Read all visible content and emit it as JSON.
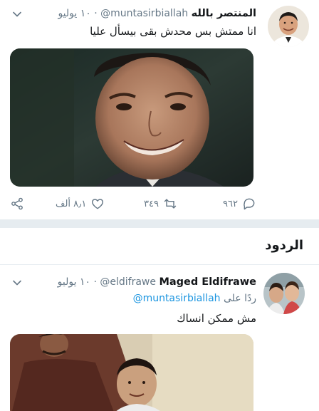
{
  "main_tweet": {
    "display_name": "المنتصر بالله",
    "handle": "@muntasirbiallah",
    "dot": "·",
    "date": "١٠ يوليو",
    "text": "انا ممتش بس محدش بقى بيسأل عليا",
    "actions": {
      "reply_count": "٩٦٢",
      "retweet_count": "٣٤٩",
      "like_count": "٨٫١ ألف"
    }
  },
  "replies_section": {
    "title": "الردود"
  },
  "reply_tweet": {
    "display_name": "Maged Eldifrawe",
    "handle": "@eldifrawe",
    "dot": "·",
    "date": "١٠ يوليو",
    "reply_prefix": "ردًا على",
    "reply_mention": "@muntasirbiallah",
    "text": "مش ممكن انساك"
  },
  "colors": {
    "accent": "#1b95e0",
    "muted": "#657786",
    "separator": "#e6ecf0"
  },
  "icons": [
    "chevron-down-icon",
    "reply-icon",
    "retweet-icon",
    "like-icon",
    "share-icon"
  ]
}
